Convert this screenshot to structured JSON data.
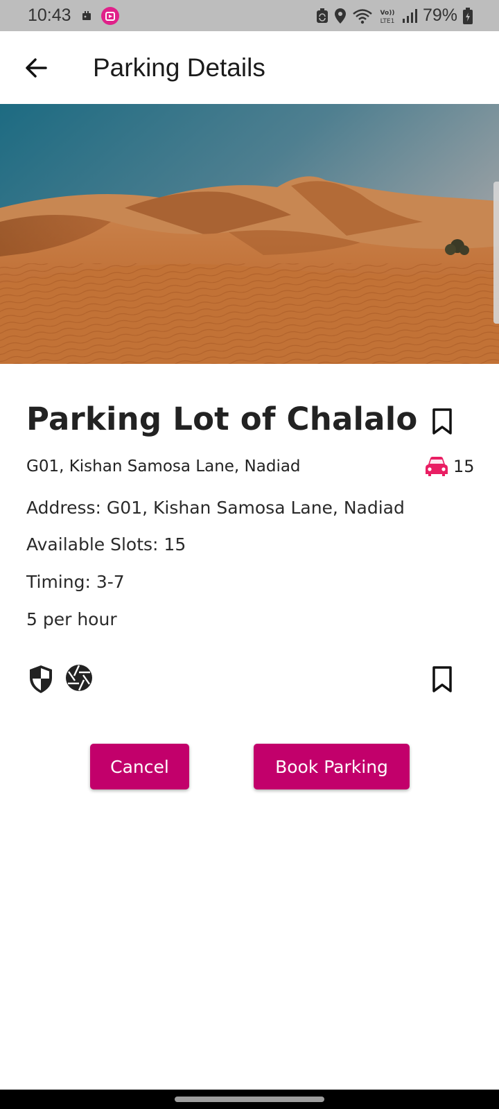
{
  "status_bar": {
    "time": "10:43",
    "battery": "79%",
    "network": "LTE1",
    "icons": [
      "notification-icon",
      "app-badge-icon",
      "sync-icon",
      "location-icon",
      "wifi-icon",
      "volte-icon",
      "signal-icon",
      "battery-icon"
    ]
  },
  "app_bar": {
    "title": "Parking Details",
    "back_icon": "arrow-back-icon"
  },
  "hero": {
    "image": "desert-dunes-photo"
  },
  "lot": {
    "name": "Parking Lot of Chalalo",
    "location": "G01, Kishan Samosa Lane, Nadiad",
    "slot_count": "15",
    "address_line": "Address: G01, Kishan Samosa Lane, Nadiad",
    "slots_line": "Available Slots: 15",
    "timing_line": "Timing: 3-7",
    "price_line": "5 per hour",
    "amenity_icons": [
      "security-shield-icon",
      "camera-shutter-icon"
    ]
  },
  "actions": {
    "cancel_label": "Cancel",
    "book_label": "Book Parking"
  },
  "colors": {
    "accent": "#c2006b",
    "car_icon": "#e91e63",
    "status_bar": "#bdbdbd"
  }
}
